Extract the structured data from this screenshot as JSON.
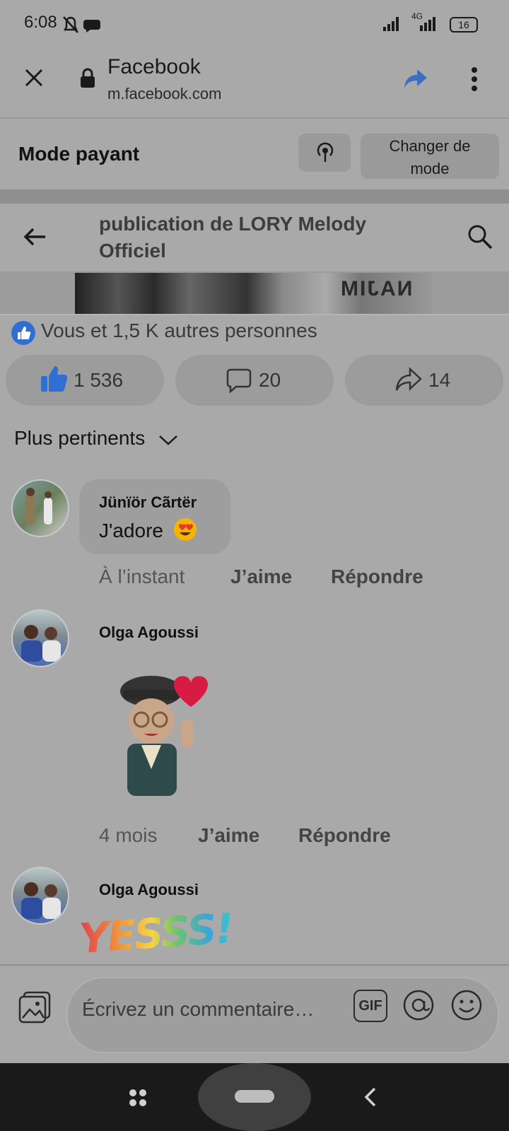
{
  "status": {
    "time": "6:08",
    "network": "4G",
    "battery": "16"
  },
  "browser": {
    "title": "Facebook",
    "url": "m.facebook.com"
  },
  "mode": {
    "title": "Mode payant",
    "change_label_1": "Changer de",
    "change_label_2": "mode"
  },
  "post": {
    "title": "publication de LORY Melody Officiel",
    "image_text": "NAJIM"
  },
  "reactions": {
    "summary": "Vous et 1,5 K autres personnes",
    "likes": "1 536",
    "comments": "20",
    "shares": "14"
  },
  "sort": {
    "label": "Plus pertinents"
  },
  "comments": [
    {
      "author": "Jünïör Cãrtër",
      "text": "J'adore",
      "time": "À l’instant",
      "like": "J’aime",
      "reply": "Répondre"
    },
    {
      "author": "Olga Agoussi",
      "time": "4 mois",
      "like": "J’aime",
      "reply": "Répondre"
    },
    {
      "author": "Olga Agoussi",
      "sticker_text": "YESSS!"
    }
  ],
  "composer": {
    "placeholder": "Écrivez un commentaire…",
    "gif": "GIF"
  },
  "colors": {
    "accent": "#2f6fd1",
    "share_arrow": "#3b6fc2"
  }
}
